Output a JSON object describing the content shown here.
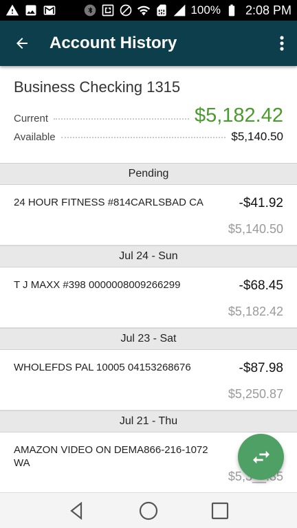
{
  "status_bar": {
    "battery": "100%",
    "time": "2:08 PM",
    "icons_left": [
      "warning-icon",
      "image-icon",
      "gmail-icon"
    ],
    "icons_right": [
      "bluetooth-icon",
      "nfc-icon",
      "mute-icon",
      "wifi-icon",
      "sim-icon",
      "signal-icon",
      "battery-icon"
    ]
  },
  "app_bar": {
    "title": "Account History",
    "background_color": "#0c3e4b"
  },
  "account": {
    "name": "Business Checking 1315",
    "current_label": "Current",
    "current_value": "$5,182.42",
    "available_label": "Available",
    "available_value": "$5,140.50",
    "current_color": "#4a9a2d"
  },
  "sections": [
    {
      "header": "Pending",
      "transactions": [
        {
          "description": "24 HOUR FITNESS #814CARLSBAD CA",
          "amount": "-$41.92",
          "balance": "$5,140.50"
        }
      ]
    },
    {
      "header": "Jul 24 - Sun",
      "transactions": [
        {
          "description": "T J MAXX #398 0000008009266299",
          "amount": "-$68.45",
          "balance": "$5,182.42"
        }
      ]
    },
    {
      "header": "Jul 23 - Sat",
      "transactions": [
        {
          "description": "WHOLEFDS PAL 10005 04153268676",
          "amount": "-$87.98",
          "balance": "$5,250.87"
        }
      ]
    },
    {
      "header": "Jul 21 - Thu",
      "transactions": [
        {
          "description": "AMAZON VIDEO ON DEMA866-216-1072 WA",
          "amount": "",
          "balance": "$5,3__.35"
        }
      ]
    }
  ],
  "fab": {
    "icon": "transfer-icon",
    "color": "#4fa064"
  },
  "nav_bar": {
    "buttons": [
      "back-icon",
      "home-icon",
      "recents-icon"
    ]
  }
}
